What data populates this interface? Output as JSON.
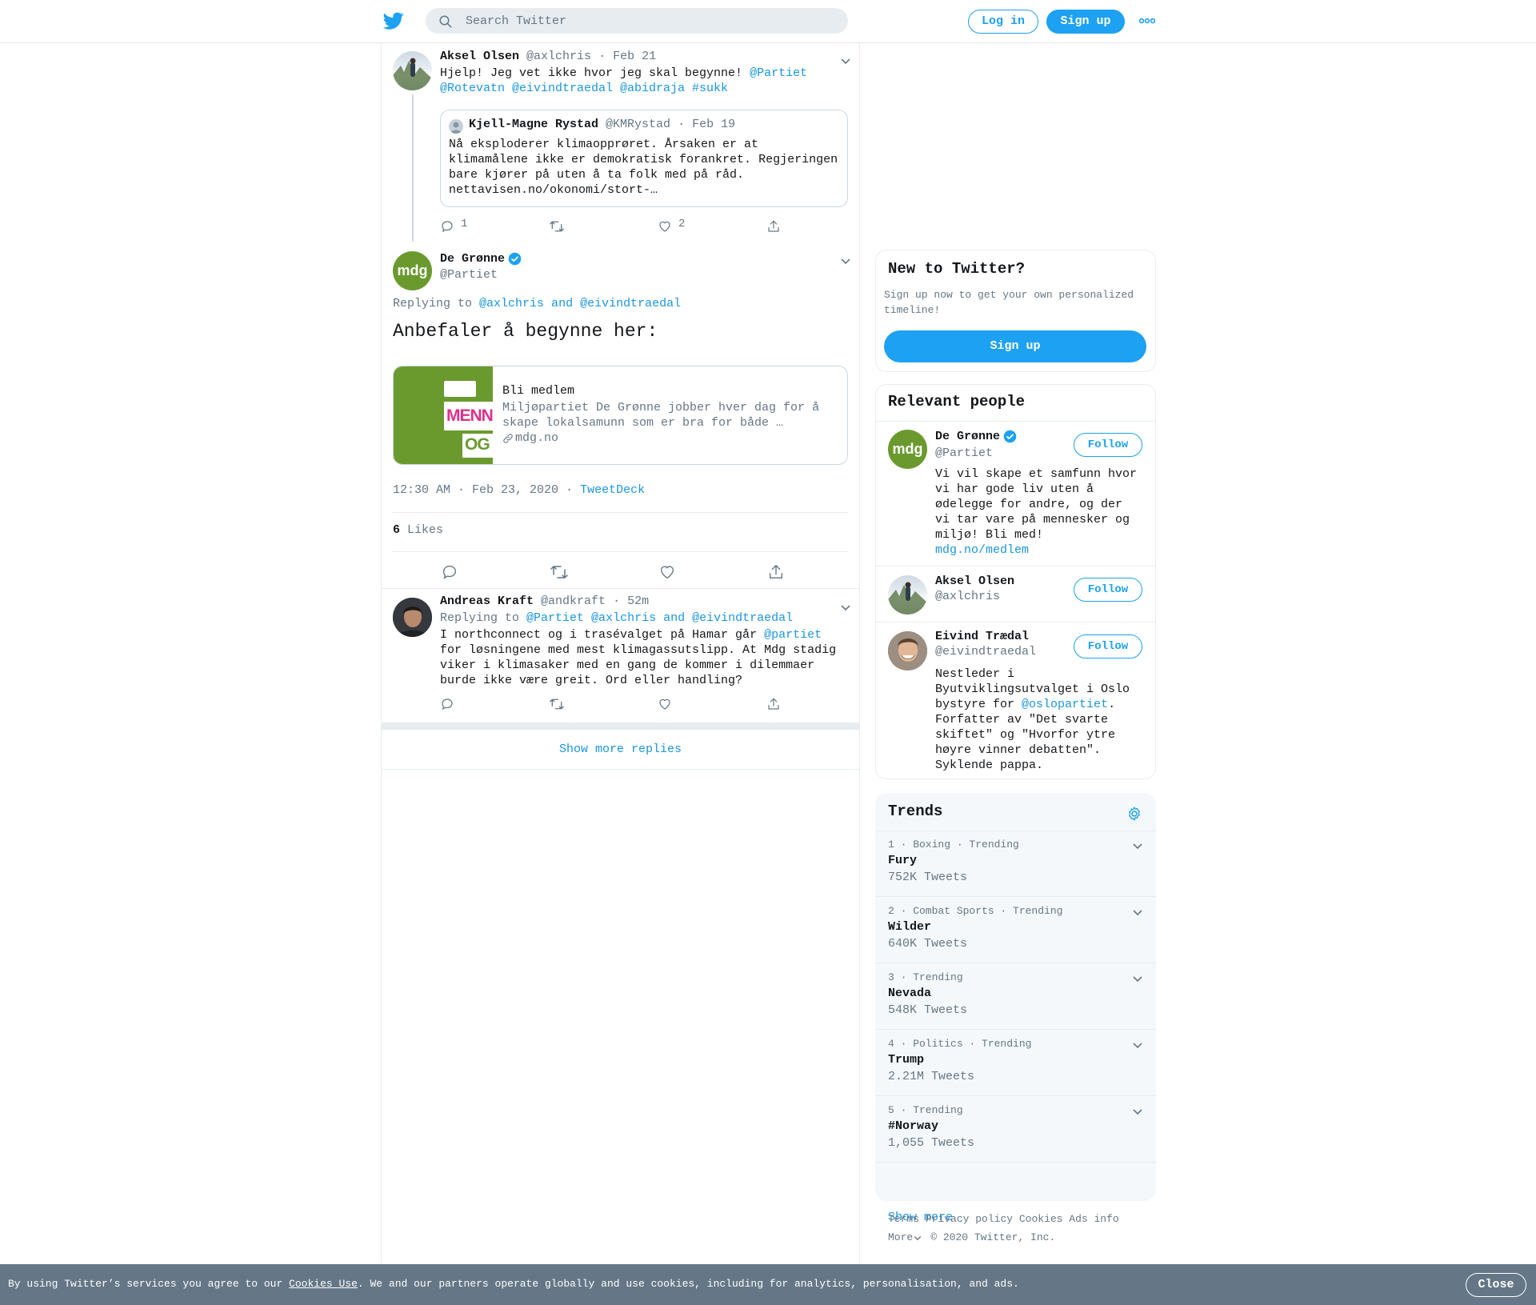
{
  "topbar": {
    "search_placeholder": "Search Twitter",
    "login_label": "Log in",
    "signup_label": "Sign up"
  },
  "tweet1": {
    "name": "Aksel Olsen",
    "handle": "@axlchris",
    "date": "Feb 21",
    "text_plain": "Hjelp! Jeg vet ikke hvor jeg skal begynne!",
    "mentions_line1": "@Partiet",
    "mentions_line2": "@Rotevatn @eivindtraedal @abidraja #sukk",
    "reply_count": "1",
    "like_count": "2",
    "quote": {
      "name": "Kjell-Magne Rystad",
      "handle": "@KMRystad",
      "date": "Feb 19",
      "text_lines": [
        "Nå eksploderer klimaopprøret. Årsaken er at",
        "klimamålene ikke er demokratisk forankret. Regjeringen",
        "bare kjører på uten å ta folk med på råd.",
        "nettavisen.no/okonomi/stort-…"
      ]
    }
  },
  "main_tweet": {
    "name": "De Grønne",
    "handle": "@Partiet",
    "avatar_text": "mdg",
    "replying_prefix": "Replying to",
    "replying_to": "@axlchris and @eivindtraedal",
    "text": "Anbefaler å begynne her:",
    "card": {
      "title": "Bli medlem",
      "desc_line1": "Miljøpartiet De Grønne jobber hver dag for å",
      "desc_line2": "skape lokalsamunn som er bra for både …",
      "domain": "mdg.no",
      "image_text1": "MENNES",
      "image_text2": "OG M"
    },
    "timestamp": "12:30 AM · Feb 23, 2020",
    "source": "TweetDeck",
    "likes_count": "6",
    "likes_label": "Likes"
  },
  "reply": {
    "name": "Andreas Kraft",
    "handle": "@andkraft",
    "date": "52m",
    "replying_prefix": "Replying to",
    "replying_to": "@Partiet @axlchris and @eivindtraedal",
    "line1_plain": "I northconnect og i trasévalget på Hamar går",
    "line1_mention": "@partiet",
    "lines": [
      "for løsningene med mest klimagassutslipp. At Mdg stadig",
      "viker i klimasaker med en gang de kommer i dilemmaer",
      "burde ikke være greit. Ord eller handling?"
    ]
  },
  "show_more_replies": "Show more replies",
  "new_to_twitter": {
    "title": "New to Twitter?",
    "desc_line1": "Sign up now to get your own personalized",
    "desc_line2": "timeline!",
    "button": "Sign up"
  },
  "relevant_people": {
    "title": "Relevant people",
    "follow_label": "Follow",
    "people": [
      {
        "name": "De Grønne",
        "handle": "@Partiet",
        "bio_lines": [
          "Vi vil skape et samfunn hvor",
          "vi har gode liv uten å",
          "ødelegge for andre, og der",
          "vi tar vare på mennesker og",
          "miljø! Bli med!"
        ],
        "link": "mdg.no/medlem"
      },
      {
        "name": "Aksel Olsen",
        "handle": "@axlchris"
      },
      {
        "name": "Eivind Trædal",
        "handle": "@eivindtraedal",
        "bio_line1": "Nestleder i",
        "bio_line2": "Byutviklingsutvalget i Oslo",
        "bio_line3_plain": "bystyre for",
        "bio_line3_mention": "@oslopartiet",
        "bio_lines_rest": [
          "Forfatter av \"Det svarte",
          "skiftet\" og \"Hvorfor ytre",
          "høyre vinner debatten\".",
          "Syklende pappa."
        ]
      }
    ]
  },
  "trends": {
    "title": "Trends",
    "items": [
      {
        "meta": "1 · Boxing · Trending",
        "name": "Fury",
        "count": "752K Tweets"
      },
      {
        "meta": "2 · Combat Sports · Trending",
        "name": "Wilder",
        "count": "640K Tweets"
      },
      {
        "meta": "3 · Trending",
        "name": "Nevada",
        "count": "548K Tweets"
      },
      {
        "meta": "4 · Politics · Trending",
        "name": "Trump",
        "count": "2.21M Tweets"
      },
      {
        "meta": "5 · Trending",
        "name": "#Norway",
        "count": "1,055 Tweets"
      }
    ],
    "show_more": "Show more"
  },
  "footer": {
    "links": [
      "Terms",
      "Privacy policy",
      "Cookies",
      "Ads info"
    ],
    "more": "More",
    "copyright": "© 2020 Twitter, Inc."
  },
  "cookie": {
    "prefix": "By using Twitter’s services you agree to our",
    "link": "Cookies Use",
    "suffix": ". We and our partners operate globally and use cookies, including for analytics, personalisation, and ads.",
    "close": "Close"
  },
  "colors": {
    "accent": "#1da1f2",
    "link": "#1b95e0",
    "muted": "#657786",
    "mdg_green": "#6a9a2e"
  }
}
